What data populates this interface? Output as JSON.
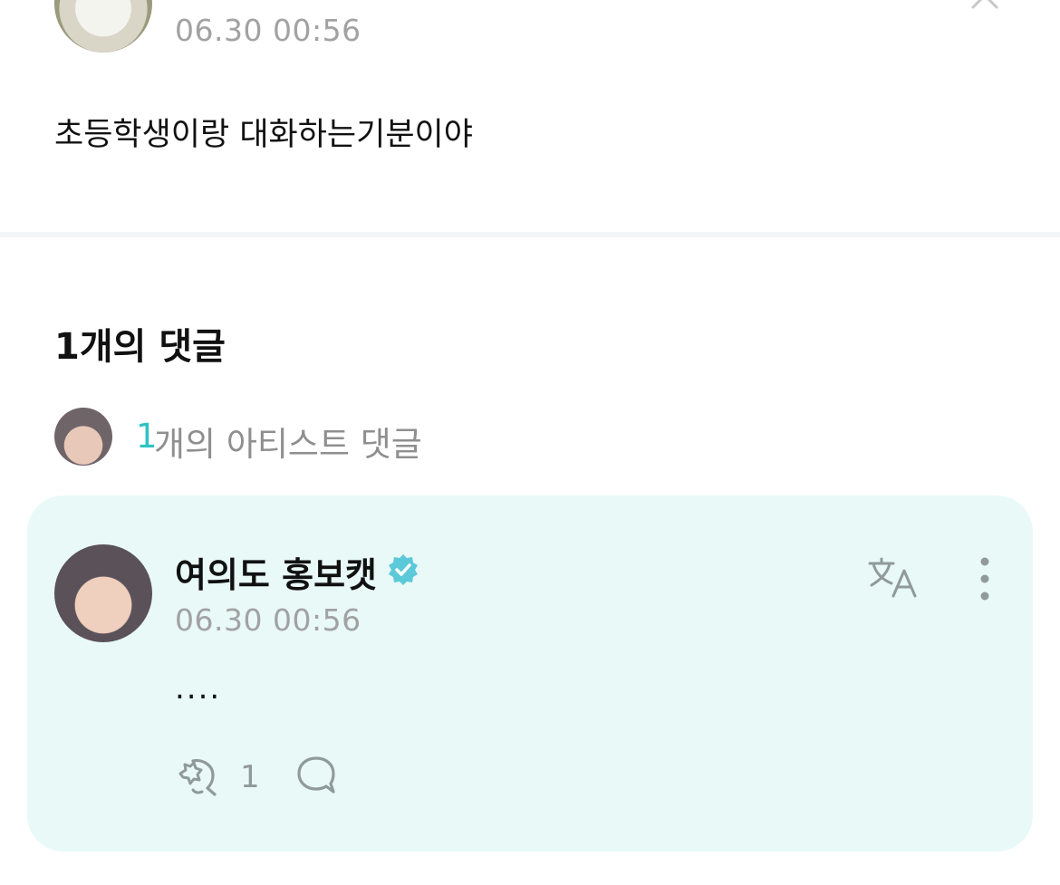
{
  "post": {
    "timestamp": "06.30 00:56",
    "text": "초등학생이랑 대화하는기분이야",
    "icons": {
      "avatar": "user-avatar-dog",
      "collapse": "chevron-up-icon"
    }
  },
  "comments": {
    "title": "1개의 댓글",
    "artist_summary": {
      "count": "1",
      "label": "개의 아티스트 댓글",
      "accent_color": "#2fc3c3"
    }
  },
  "comment": {
    "author": "여의도 홍보캣",
    "verified": true,
    "timestamp": "06.30 00:56",
    "text": "....",
    "like_count": "1",
    "card_color": "#e8f9f7",
    "icons": {
      "avatar": "artist-avatar",
      "verified": "verified-badge-icon",
      "translate": "translate-icon",
      "more": "more-vertical-icon",
      "like": "like-icon",
      "reply": "reply-bubble-icon"
    }
  }
}
